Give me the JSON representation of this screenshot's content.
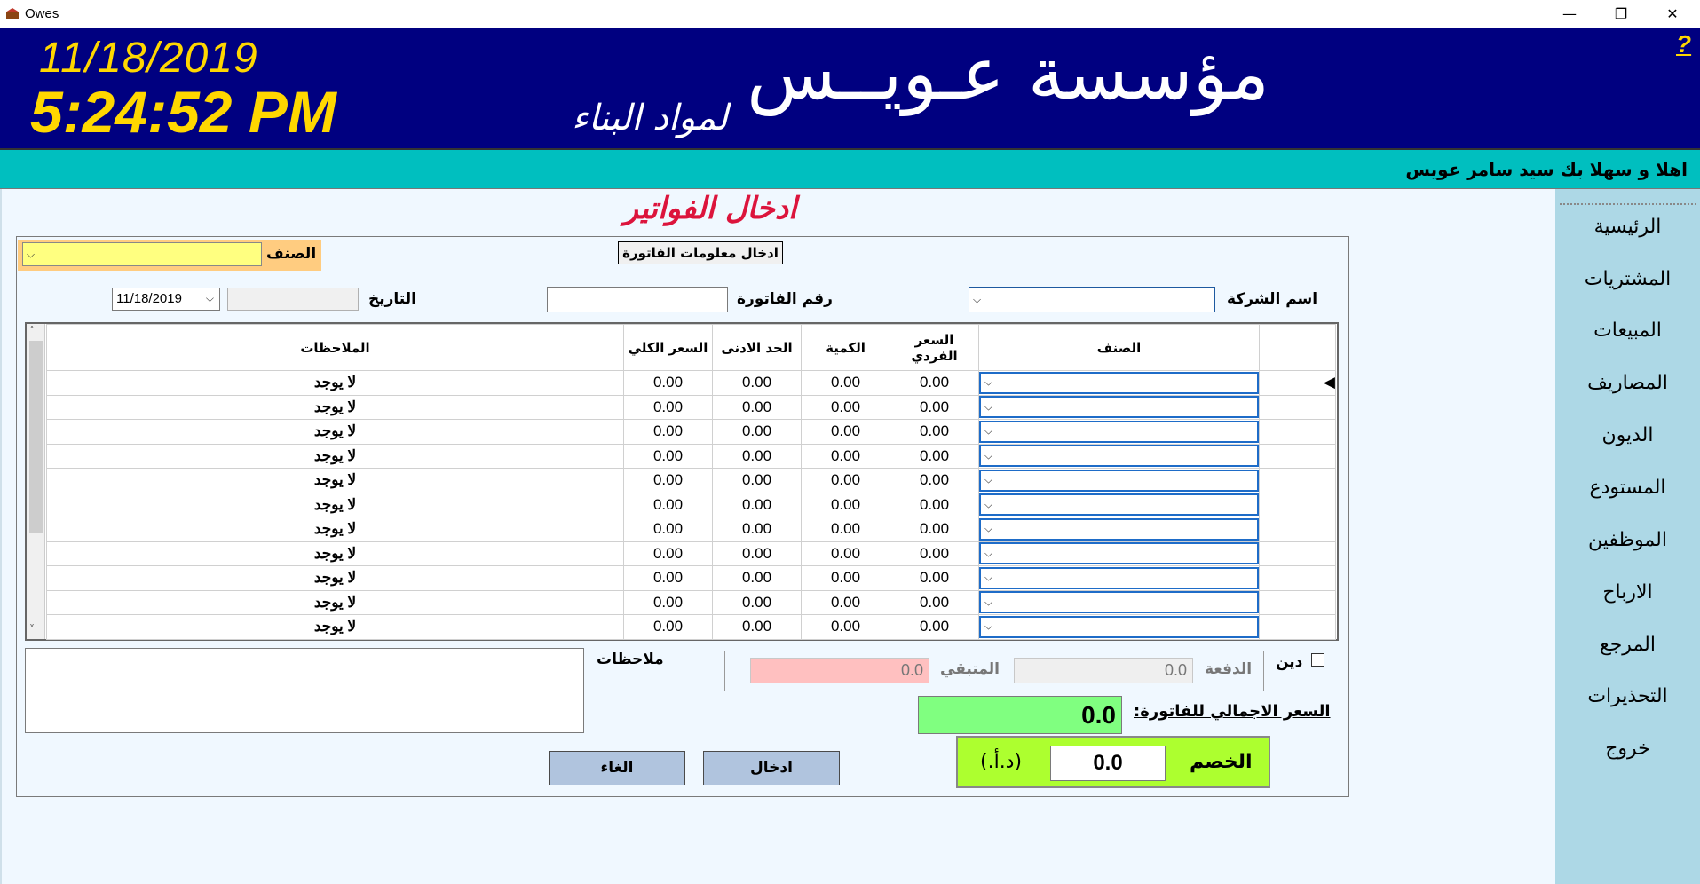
{
  "window": {
    "title": "Owes",
    "minimize_glyph": "—",
    "restore_glyph": "❐",
    "close_glyph": "✕"
  },
  "header": {
    "date": "11/18/2019",
    "time": "5:24:52 PM",
    "company_name": "مؤسسة عـويــس",
    "company_subtitle": "لمواد البناء",
    "help": "?"
  },
  "welcome": "اهلا و سهلا بك سيد سامر عويس",
  "sidebar": {
    "items": [
      {
        "label": "الرئيسية"
      },
      {
        "label": "المشتريات"
      },
      {
        "label": "المبيعات"
      },
      {
        "label": "المصاريف"
      },
      {
        "label": "الديون"
      },
      {
        "label": "المستودع"
      },
      {
        "label": "الموظفين"
      },
      {
        "label": "الارباح"
      },
      {
        "label": "المرجع"
      },
      {
        "label": "التحذيرات"
      },
      {
        "label": "خروج"
      }
    ]
  },
  "page_title": "ادخال الفواتير",
  "form": {
    "category_label": "الصنف",
    "category_value": "",
    "info_button": "ادخال معلومات الفاتورة",
    "company_label": "اسم الشركة",
    "company_value": "",
    "invoice_label": "رقم الفاتورة",
    "invoice_value": "",
    "date_label": "التاريخ",
    "date_value": "11/18/2019"
  },
  "grid": {
    "headers": {
      "notes": "الملاحظات",
      "total_price": "السعر الكلي",
      "min_limit": "الحد الادنى",
      "quantity": "الكمية",
      "unit_price": "السعر الفردي",
      "category": "الصنف"
    },
    "rows": [
      {
        "notes": "لا يوجد",
        "total": "0.00",
        "min": "0.00",
        "qty": "0.00",
        "unit": "0.00"
      },
      {
        "notes": "لا يوجد",
        "total": "0.00",
        "min": "0.00",
        "qty": "0.00",
        "unit": "0.00"
      },
      {
        "notes": "لا يوجد",
        "total": "0.00",
        "min": "0.00",
        "qty": "0.00",
        "unit": "0.00"
      },
      {
        "notes": "لا يوجد",
        "total": "0.00",
        "min": "0.00",
        "qty": "0.00",
        "unit": "0.00"
      },
      {
        "notes": "لا يوجد",
        "total": "0.00",
        "min": "0.00",
        "qty": "0.00",
        "unit": "0.00"
      },
      {
        "notes": "لا يوجد",
        "total": "0.00",
        "min": "0.00",
        "qty": "0.00",
        "unit": "0.00"
      },
      {
        "notes": "لا يوجد",
        "total": "0.00",
        "min": "0.00",
        "qty": "0.00",
        "unit": "0.00"
      },
      {
        "notes": "لا يوجد",
        "total": "0.00",
        "min": "0.00",
        "qty": "0.00",
        "unit": "0.00"
      },
      {
        "notes": "لا يوجد",
        "total": "0.00",
        "min": "0.00",
        "qty": "0.00",
        "unit": "0.00"
      },
      {
        "notes": "لا يوجد",
        "total": "0.00",
        "min": "0.00",
        "qty": "0.00",
        "unit": "0.00"
      },
      {
        "notes": "لا يوجد",
        "total": "0.00",
        "min": "0.00",
        "qty": "0.00",
        "unit": "0.00"
      }
    ]
  },
  "footer": {
    "notes_label": "ملاحظات",
    "notes_value": "",
    "debt_label": "دين",
    "debt_checked": false,
    "paid_label": "الدفعة",
    "paid_value": "0.0",
    "remaining_label": "المتبقي",
    "remaining_value": "0.0",
    "total_label": "السعر الاجمالي للفاتورة:",
    "total_value": "0.0",
    "discount_label": "الخصم",
    "discount_value": "0.0",
    "currency_label": "(د.أ.)",
    "enter_button": "ادخال",
    "cancel_button": "الغاء"
  },
  "colors": {
    "header_bg": "#000080",
    "clock": "#ffd700",
    "welcome_bg": "#00bfbf",
    "sidebar_bg": "#add8e6",
    "title": "#dc143c",
    "total_bg": "#80ff80",
    "discount_bg": "#adff2f",
    "remaining_bg": "#ffc0c0"
  }
}
